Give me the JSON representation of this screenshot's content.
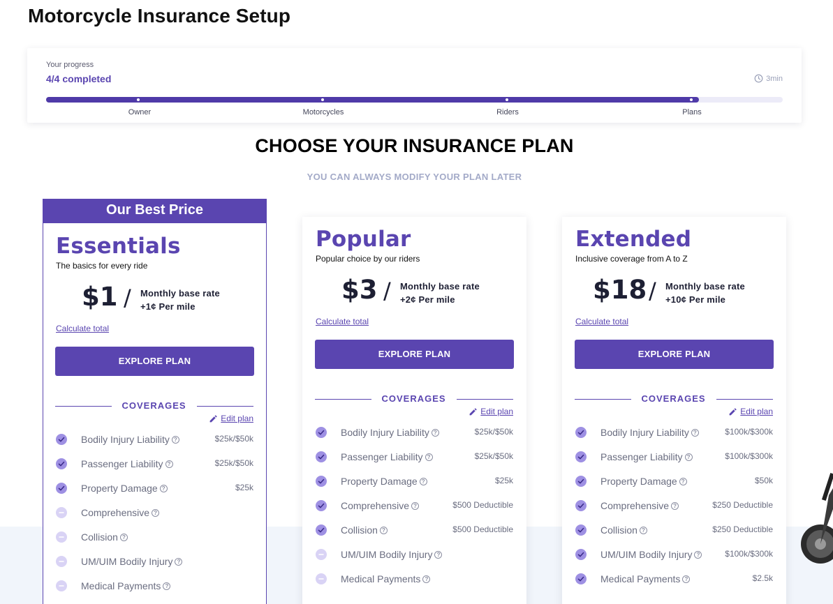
{
  "page": {
    "title": "Motorcycle Insurance Setup"
  },
  "progress": {
    "label": "Your progress",
    "count": "4/4 completed",
    "time": "3min",
    "completion": 0.886,
    "steps": [
      "Owner",
      "Motorcycles",
      "Riders",
      "Plans"
    ]
  },
  "heading": "CHOOSE YOUR INSURANCE PLAN",
  "subheading": "YOU CAN ALWAYS MODIFY YOUR PLAN LATER",
  "best_badge": "Our Best Price",
  "colors": {
    "accent": "#5a45b0",
    "check_on": "#9e90e3",
    "check_off": "#d9d3f5",
    "muted_heading": "#a3aac8"
  },
  "plans": [
    {
      "name": "Essentials",
      "description": "The basics for every ride",
      "price": "$1",
      "slash": "/",
      "rate_line1": "Monthly base rate",
      "rate_line2": "+1¢ Per mile",
      "calc_link": "Calculate total",
      "cta": "EXPLORE PLAN",
      "coverages_title": "COVERAGES",
      "edit_label": "Edit plan",
      "coverages": [
        {
          "name": "Bodily Injury Liability",
          "value": "$25k/$50k",
          "included": true
        },
        {
          "name": "Passenger Liability",
          "value": "$25k/$50k",
          "included": true
        },
        {
          "name": "Property Damage",
          "value": "$25k",
          "included": true
        },
        {
          "name": "Comprehensive",
          "value": "",
          "included": false
        },
        {
          "name": "Collision",
          "value": "",
          "included": false
        },
        {
          "name": "UM/UIM Bodily Injury",
          "value": "",
          "included": false
        },
        {
          "name": "Medical Payments",
          "value": "",
          "included": false
        }
      ]
    },
    {
      "name": "Popular",
      "description": "Popular choice by our riders",
      "price": "$3",
      "slash": "/",
      "rate_line1": "Monthly base rate",
      "rate_line2": "+2¢ Per mile",
      "calc_link": "Calculate total",
      "cta": "EXPLORE PLAN",
      "coverages_title": "COVERAGES",
      "edit_label": "Edit plan",
      "coverages": [
        {
          "name": "Bodily Injury Liability",
          "value": "$25k/$50k",
          "included": true
        },
        {
          "name": "Passenger Liability",
          "value": "$25k/$50k",
          "included": true
        },
        {
          "name": "Property Damage",
          "value": "$25k",
          "included": true
        },
        {
          "name": "Comprehensive",
          "value": "$500 Deductible",
          "included": true
        },
        {
          "name": "Collision",
          "value": "$500 Deductible",
          "included": true
        },
        {
          "name": "UM/UIM Bodily Injury",
          "value": "",
          "included": false
        },
        {
          "name": "Medical Payments",
          "value": "",
          "included": false
        }
      ]
    },
    {
      "name": "Extended",
      "description": "Inclusive coverage from A to Z",
      "price": "$18",
      "slash": "/",
      "rate_line1": "Monthly base rate",
      "rate_line2": "+10¢ Per mile",
      "calc_link": "Calculate total",
      "cta": "EXPLORE PLAN",
      "coverages_title": "COVERAGES",
      "edit_label": "Edit plan",
      "coverages": [
        {
          "name": "Bodily Injury Liability",
          "value": "$100k/$300k",
          "included": true
        },
        {
          "name": "Passenger Liability",
          "value": "$100k/$300k",
          "included": true
        },
        {
          "name": "Property Damage",
          "value": "$50k",
          "included": true
        },
        {
          "name": "Comprehensive",
          "value": "$250 Deductible",
          "included": true
        },
        {
          "name": "Collision",
          "value": "$250 Deductible",
          "included": true
        },
        {
          "name": "UM/UIM Bodily Injury",
          "value": "$100k/$300k",
          "included": true
        },
        {
          "name": "Medical Payments",
          "value": "$2.5k",
          "included": true
        }
      ]
    }
  ]
}
